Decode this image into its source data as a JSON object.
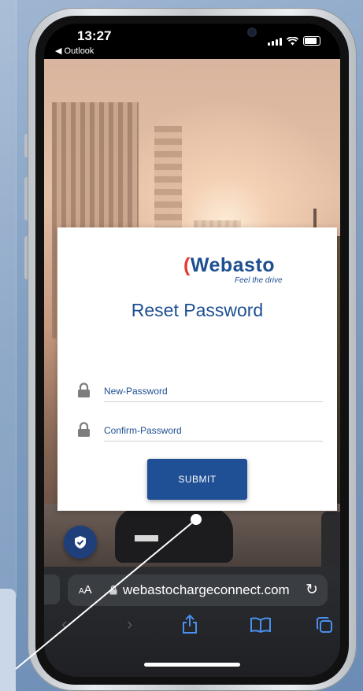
{
  "status_bar": {
    "time": "13:27",
    "back_app": "◀ Outlook",
    "icons": [
      "signal-icon",
      "wifi-icon",
      "battery-icon"
    ]
  },
  "brand": {
    "logo_text": "Webasto",
    "tagline": "Feel the drive",
    "primary_color": "#1d4f91",
    "accent_color": "#e23b2e"
  },
  "reset_form": {
    "title": "Reset Password",
    "new_password_placeholder": "New-Password",
    "confirm_password_placeholder": "Confirm-Password",
    "submit_label": "SUBMIT"
  },
  "privacy_badge": {
    "icon": "shield-check-icon"
  },
  "safari": {
    "text_size_label": "AA",
    "url": "webastochargeconnect.com",
    "toolbar": [
      "back-icon",
      "forward-icon",
      "share-icon",
      "bookmarks-icon",
      "tabs-icon"
    ]
  }
}
